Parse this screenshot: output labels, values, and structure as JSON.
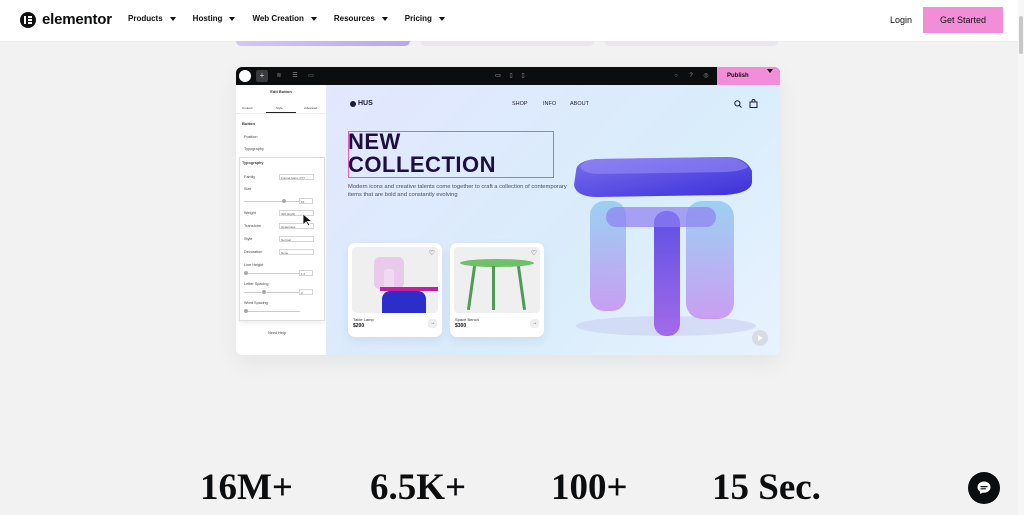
{
  "brand": {
    "name": "elementor"
  },
  "nav": {
    "items": [
      {
        "label": "Products"
      },
      {
        "label": "Hosting"
      },
      {
        "label": "Web Creation"
      },
      {
        "label": "Resources"
      },
      {
        "label": "Pricing"
      }
    ],
    "login": "Login",
    "cta": "Get Started"
  },
  "editor": {
    "publish": "Publish",
    "panel": {
      "title": "Edit Button",
      "tabs": [
        "Content",
        "Style",
        "Advanced"
      ],
      "section": "Button",
      "position_label": "Position",
      "typography_label": "Typography",
      "popup_title": "Typography",
      "family_label": "Family",
      "family_value": "Funnel Sans, AYT",
      "size_label": "Size",
      "size_value": "16",
      "weight_label": "Weight",
      "weight_value": "300 (Light)",
      "transform_label": "Transform",
      "transform_value": "Uppercase",
      "style_label": "Style",
      "style_value": "Normal",
      "decoration_label": "Decoration",
      "decoration_value": "None",
      "line_height_label": "Line Height",
      "line_height_value": "1.2",
      "letter_spacing_label": "Letter Spacing",
      "letter_spacing_value": "0",
      "word_spacing_label": "Word Spacing",
      "need_help": "Need Help"
    },
    "preview": {
      "logo": "HUS",
      "nav": [
        "SHOP",
        "INFO",
        "ABOUT"
      ],
      "headline_1": "NEW",
      "headline_2": "COLLECTION",
      "subtext": "Modern icons and creative talents come together to craft a collection of contemporary items that are bold and constantly evolving",
      "products": [
        {
          "name": "Table Lamp",
          "price": "$200"
        },
        {
          "name": "Space Bench",
          "price": "$300"
        }
      ]
    }
  },
  "stats": [
    "16M+",
    "6.5K+",
    "100+",
    "15 Sec."
  ],
  "colors": {
    "accent": "#f28dd8",
    "dark": "#0c0d0e",
    "headline": "#1d0f3e"
  }
}
